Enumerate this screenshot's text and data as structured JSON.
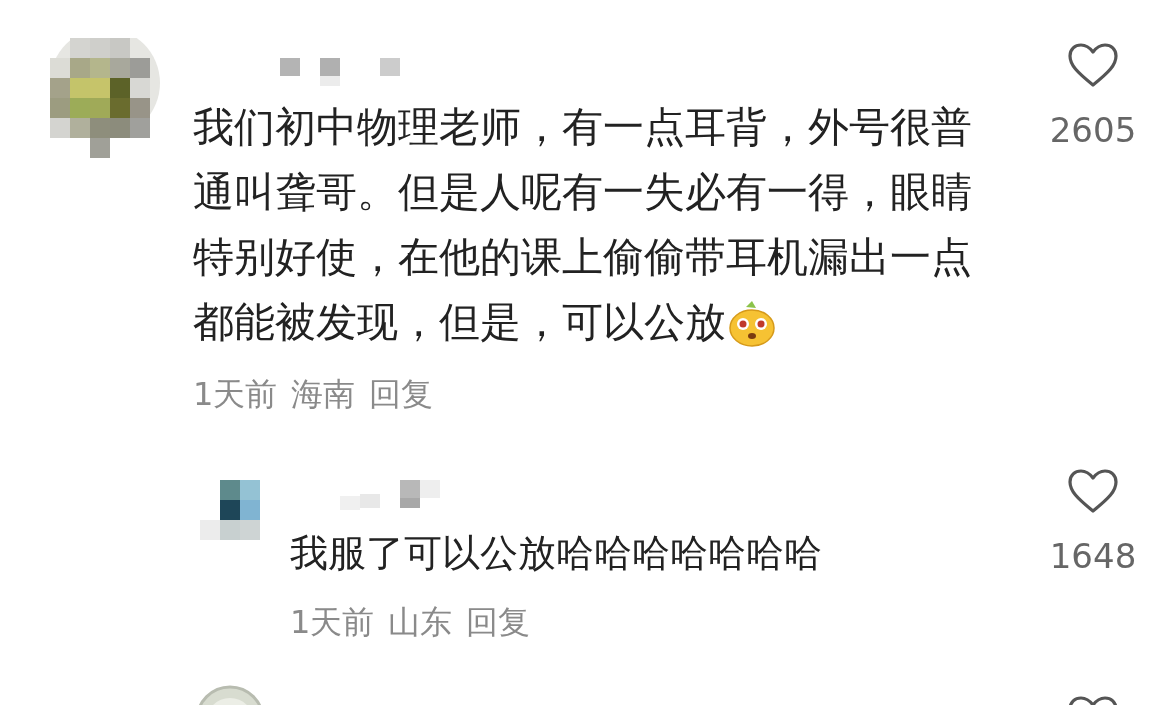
{
  "comments": [
    {
      "kind": "top",
      "text": "我们初中物理老师，有一点耳背，外号很普通叫聋哥。但是人呢有一失必有一得，眼睛特别好使，在他的课上偷偷带耳机漏出一点都能被发现，但是，可以公放",
      "has_emoji": true,
      "likes": "2605",
      "liked": false,
      "time": "1天前",
      "region": "海南",
      "reply": "回复"
    },
    {
      "kind": "reply",
      "text": "我服了可以公放哈哈哈哈哈哈哈",
      "has_emoji": false,
      "likes": "1648",
      "liked": false,
      "time": "1天前",
      "region": "山东",
      "reply": "回复"
    },
    {
      "kind": "partial",
      "liked": false
    }
  ]
}
